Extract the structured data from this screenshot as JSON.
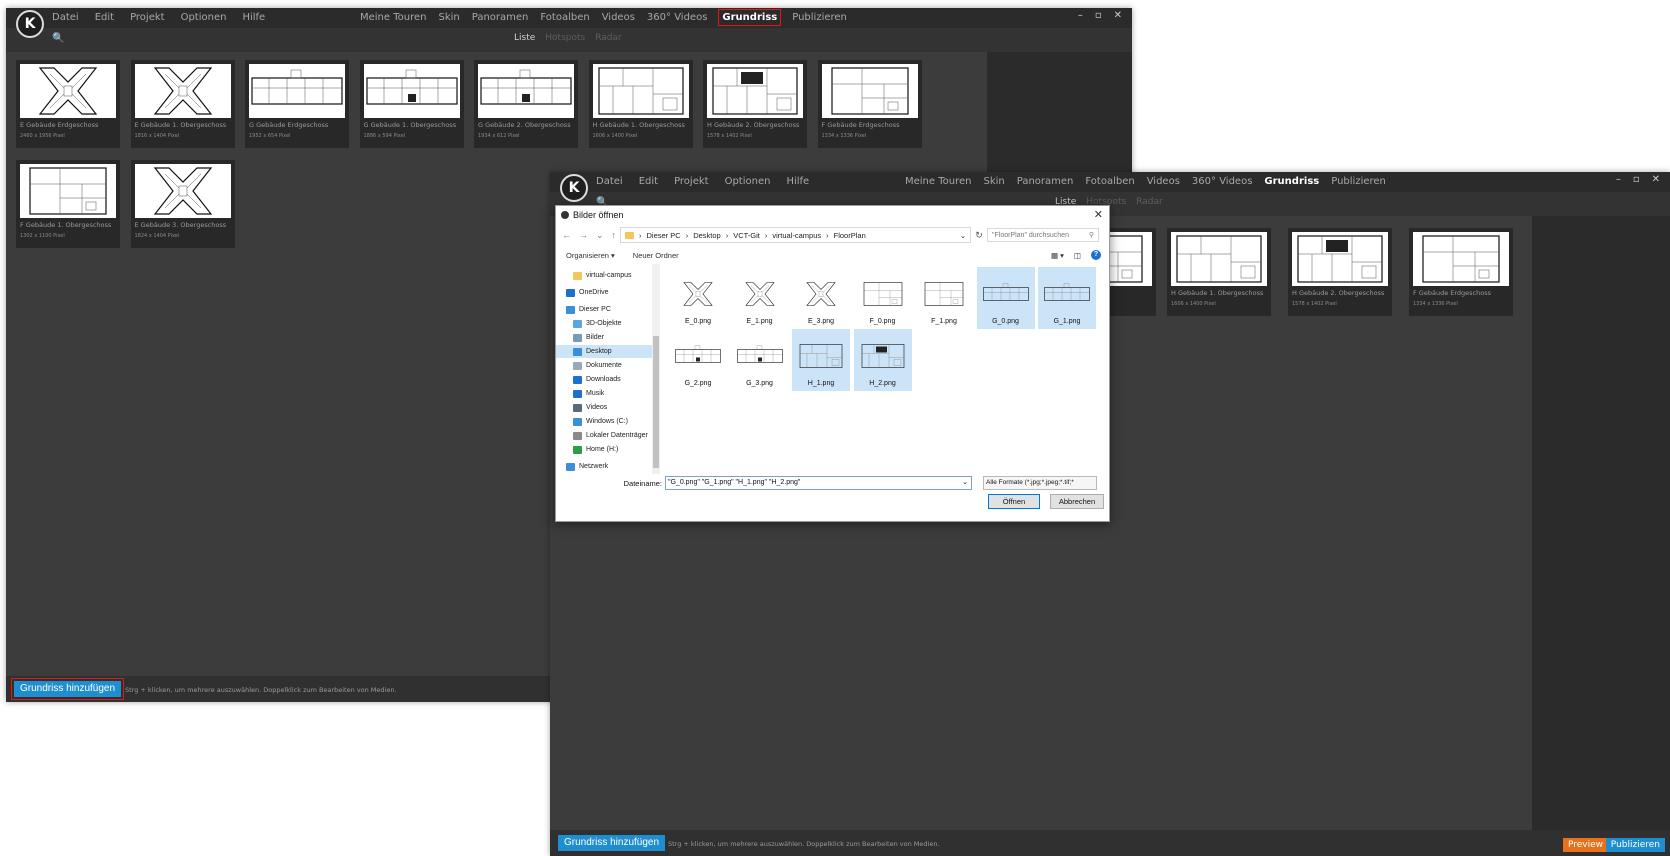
{
  "app": {
    "logo_letter": "K",
    "menu": [
      "Datei",
      "Edit",
      "Projekt",
      "Optionen",
      "Hilfe"
    ],
    "nav": [
      "Meine Touren",
      "Skin",
      "Panoramen",
      "Fotoalben",
      "Videos",
      "360° Videos",
      "Grundriss",
      "Publizieren"
    ],
    "active_nav": "Grundriss",
    "window_controls": [
      "–",
      "▫",
      "✕"
    ],
    "search_icon": "🔍",
    "view_tabs": [
      "Liste",
      "Hotspots",
      "Radar"
    ],
    "active_tab": "Liste"
  },
  "floorplans": [
    {
      "name": "E Gebäude Erdgeschoss",
      "dims": "2460 x 1956 Pixel",
      "shape": "x"
    },
    {
      "name": "E Gebäude 1. Obergeschoss",
      "dims": "1816 x 1404 Pixel",
      "shape": "x"
    },
    {
      "name": "G Gebäude Erdgeschoss",
      "dims": "1952 x 654 Pixel",
      "shape": "wide"
    },
    {
      "name": "G Gebäude 1. Obergeschoss",
      "dims": "1886 x 594 Pixel",
      "shape": "wide2"
    },
    {
      "name": "G Gebäude 2. Obergeschoss",
      "dims": "1934 x 612 Pixel",
      "shape": "wide2"
    },
    {
      "name": "H Gebäude 1. Obergeschoss",
      "dims": "1606 x 1400 Pixel",
      "shape": "h"
    },
    {
      "name": "H Gebäude 2. Obergeschoss",
      "dims": "1578 x 1402 Pixel",
      "shape": "h2"
    },
    {
      "name": "F Gebäude Erdgeschoss",
      "dims": "1334 x 1336 Pixel",
      "shape": "f"
    },
    {
      "name": "F Gebäude 1. Obergeschoss",
      "dims": "1302 x 1100 Pixel",
      "shape": "f"
    },
    {
      "name": "E Gebäude 3. Obergeschoss",
      "dims": "1824 x 1404 Pixel",
      "shape": "x"
    }
  ],
  "background_cards": [
    {
      "name": "...rgeschoss",
      "dims": "",
      "shape": "f"
    },
    {
      "name": "H Gebäude 1. Obergeschoss",
      "dims": "1606 x 1400 Pixel",
      "shape": "h"
    },
    {
      "name": "H Gebäude 2. Obergeschoss",
      "dims": "1578 x 1402 Pixel",
      "shape": "h2"
    },
    {
      "name": "F Gebäude Erdgeschoss",
      "dims": "1334 x 1336 Pixel",
      "shape": "f"
    }
  ],
  "statusbar": {
    "add_button": "Grundriss hinzufügen",
    "hint": "Strg + klicken, um mehrere auszuwählen. Doppelklick zum Bearbeiten von Medien.",
    "preview": "Preview",
    "publish": "Publizieren"
  },
  "dialog": {
    "title": "Bilder öffnen",
    "close": "✕",
    "path": [
      "Dieser PC",
      "Desktop",
      "VCT-Git",
      "virtual-campus",
      "FloorPlan"
    ],
    "search_placeholder": "\"FloorPlan\" durchsuchen",
    "organize": "Organisieren ▾",
    "new_folder": "Neuer Ordner",
    "tree": [
      {
        "label": "virtual-campus",
        "icon": "folder-icon",
        "color": "#f3c75a",
        "indent": 1,
        "selected": false
      },
      {
        "label": "OneDrive",
        "icon": "cloud-icon",
        "color": "#1e6fd0",
        "indent": 0,
        "selected": false
      },
      {
        "label": "Dieser PC",
        "icon": "computer-icon",
        "color": "#3b8fd9",
        "indent": 0,
        "selected": false
      },
      {
        "label": "3D-Objekte",
        "icon": "cube-icon",
        "color": "#5aa7e0",
        "indent": 1,
        "selected": false
      },
      {
        "label": "Bilder",
        "icon": "pictures-icon",
        "color": "#7a98b8",
        "indent": 1,
        "selected": false
      },
      {
        "label": "Desktop",
        "icon": "desktop-icon",
        "color": "#3b8fd9",
        "indent": 1,
        "selected": true
      },
      {
        "label": "Dokumente",
        "icon": "documents-icon",
        "color": "#9aa9bb",
        "indent": 1,
        "selected": false
      },
      {
        "label": "Downloads",
        "icon": "download-icon",
        "color": "#1e6fd0",
        "indent": 1,
        "selected": false
      },
      {
        "label": "Musik",
        "icon": "music-icon",
        "color": "#1e6fd0",
        "indent": 1,
        "selected": false
      },
      {
        "label": "Videos",
        "icon": "videos-icon",
        "color": "#5a6a7a",
        "indent": 1,
        "selected": false
      },
      {
        "label": "Windows (C:)",
        "icon": "drive-icon",
        "color": "#3b8fd9",
        "indent": 1,
        "selected": false
      },
      {
        "label": "Lokaler Datenträger",
        "icon": "drive-icon",
        "color": "#8a8a8a",
        "indent": 1,
        "selected": false
      },
      {
        "label": "Home (H:)",
        "icon": "network-drive-icon",
        "color": "#2e9e44",
        "indent": 1,
        "selected": false
      },
      {
        "label": "Netzwerk",
        "icon": "network-icon",
        "color": "#3b8fd9",
        "indent": 0,
        "selected": false
      }
    ],
    "files": [
      {
        "name": "E_0.png",
        "shape": "x",
        "selected": false
      },
      {
        "name": "E_1.png",
        "shape": "x",
        "selected": false
      },
      {
        "name": "E_3.png",
        "shape": "x",
        "selected": false
      },
      {
        "name": "F_0.png",
        "shape": "f",
        "selected": false
      },
      {
        "name": "F_1.png",
        "shape": "f",
        "selected": false
      },
      {
        "name": "G_0.png",
        "shape": "wide",
        "selected": true
      },
      {
        "name": "G_1.png",
        "shape": "wide",
        "selected": true
      },
      {
        "name": "G_2.png",
        "shape": "wide2",
        "selected": false
      },
      {
        "name": "G_3.png",
        "shape": "wide2",
        "selected": false
      },
      {
        "name": "H_1.png",
        "shape": "h",
        "selected": true
      },
      {
        "name": "H_2.png",
        "shape": "h2",
        "selected": true
      }
    ],
    "filename_label": "Dateiname:",
    "filename_value": "\"G_0.png\" \"G_1.png\" \"H_1.png\" \"H_2.png\"",
    "filetype": "Alle Formate (*.jpg;*.jpeg;*.tif;*",
    "open": "Öffnen",
    "cancel": "Abbrechen"
  },
  "colors": {
    "accent": "#1f8ed1",
    "preview": "#e8721c",
    "highlight": "#e01818",
    "selection": "#cce4f7"
  }
}
